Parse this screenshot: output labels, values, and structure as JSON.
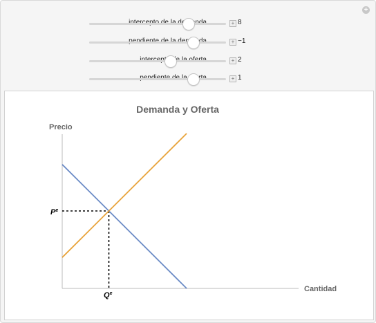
{
  "controls": [
    {
      "label": "intercepto de la demanda",
      "value": "8",
      "thumb_fraction": 0.72
    },
    {
      "label": "pendiente de la demanda",
      "value": "−1",
      "thumb_fraction": 0.76
    },
    {
      "label": "intercepto de la oferta",
      "value": "2",
      "thumb_fraction": 0.59
    },
    {
      "label": "pendiente de la oferta",
      "value": "1",
      "thumb_fraction": 0.76
    }
  ],
  "chart_data": {
    "type": "line",
    "title": "Demanda y Oferta",
    "ylabel": "Precio",
    "xlabel": "Cantidad",
    "equilibrium_price_label": "P",
    "equilibrium_price_sup": "e",
    "equilibrium_quantity_label": "Q",
    "equilibrium_quantity_sup": "e",
    "xlim": [
      0,
      8
    ],
    "ylim": [
      0,
      10
    ],
    "series": [
      {
        "color": "#6b8bc6",
        "x": [
          0,
          8
        ],
        "y": [
          8,
          0
        ]
      },
      {
        "color": "#e8a33a",
        "x": [
          0,
          8
        ],
        "y": [
          2,
          10
        ]
      }
    ],
    "equilibrium": {
      "x": 3,
      "y": 5
    },
    "grid": false
  }
}
